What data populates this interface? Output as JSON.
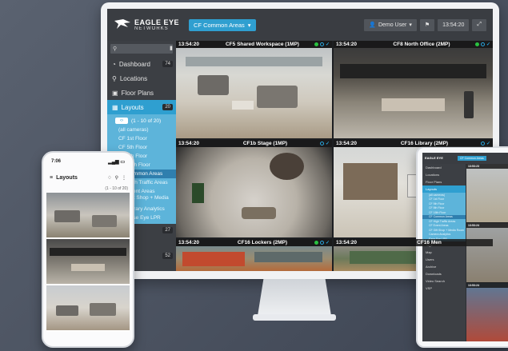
{
  "app": {
    "logo_line1": "EAGLE EYE",
    "logo_line2": "NETWORKS",
    "layout_dropdown": "CF Common Areas",
    "user_label": "Demo User",
    "clock": "13:54:20"
  },
  "sidebar": {
    "search_placeholder": "",
    "items": [
      {
        "label": "Dashboard",
        "icon": "dashboard-icon",
        "badge": "74"
      },
      {
        "label": "Locations",
        "icon": "location-pin-icon"
      },
      {
        "label": "Floor Plans",
        "icon": "floor-plan-icon"
      },
      {
        "label": "Layouts",
        "icon": "grid-icon",
        "badge": "20"
      }
    ],
    "pager_text": "(1 - 10 of 20)",
    "layout_list": [
      "(all cameras)",
      "CF 1st Floor",
      "CF 5th Floor",
      "CF 8th Floor",
      "CF 16th Floor",
      "CF Common Areas",
      "CF High Traffic Areas",
      "CF Event Areas",
      "CF Gift Shop + Media Room",
      "CF Library Analytics",
      "CF Ease Eye LPR"
    ],
    "lower_badge_1": "27",
    "lower_badge_2": "52"
  },
  "cameras": [
    {
      "time": "13:54:20",
      "name": "CF5 Shared Workspace (1MP)"
    },
    {
      "time": "13:54:20",
      "name": "CF8 North Office (2MP)"
    },
    {
      "time": "13:54:20",
      "name": "CF1b Stage (1MP)"
    },
    {
      "time": "13:54:20",
      "name": "CF16 Library (2MP)"
    },
    {
      "time": "13:54:20",
      "name": "CF16 Lockers (2MP)"
    },
    {
      "time": "13:54:20",
      "name": "CF16 Men"
    }
  ],
  "phone": {
    "time": "7:06",
    "title": "Layouts",
    "sub_left": "",
    "sub_right": "(1 - 10 of 20)"
  },
  "tablet": {
    "logo": "EAGLE EYE",
    "dropdown": "CF Common Areas",
    "items": [
      "Dashboard",
      "Locations",
      "Floor Plans",
      "Layouts"
    ],
    "sub_items": [
      "(all cameras)",
      "CF 1st Floor",
      "CF 5th Floor",
      "CF 8th Floor",
      "CF 16th Floor",
      "CF Common Areas",
      "CF High Traffic Areas",
      "CF Event Areas",
      "CF Gift Shop + Media Room",
      "Camera Analytics",
      "Ease Eye LPR"
    ],
    "lower_items": [
      "Tags",
      "Map",
      "Users",
      "Archive",
      "Downloads",
      "Video Search",
      "VSP"
    ],
    "cam_times": [
      "13:53:23",
      "13:53:24",
      "13:53:24"
    ]
  },
  "colors": {
    "accent": "#2f9fd0",
    "sidebar_bg": "#3c3f44",
    "status_green": "#29c140"
  }
}
